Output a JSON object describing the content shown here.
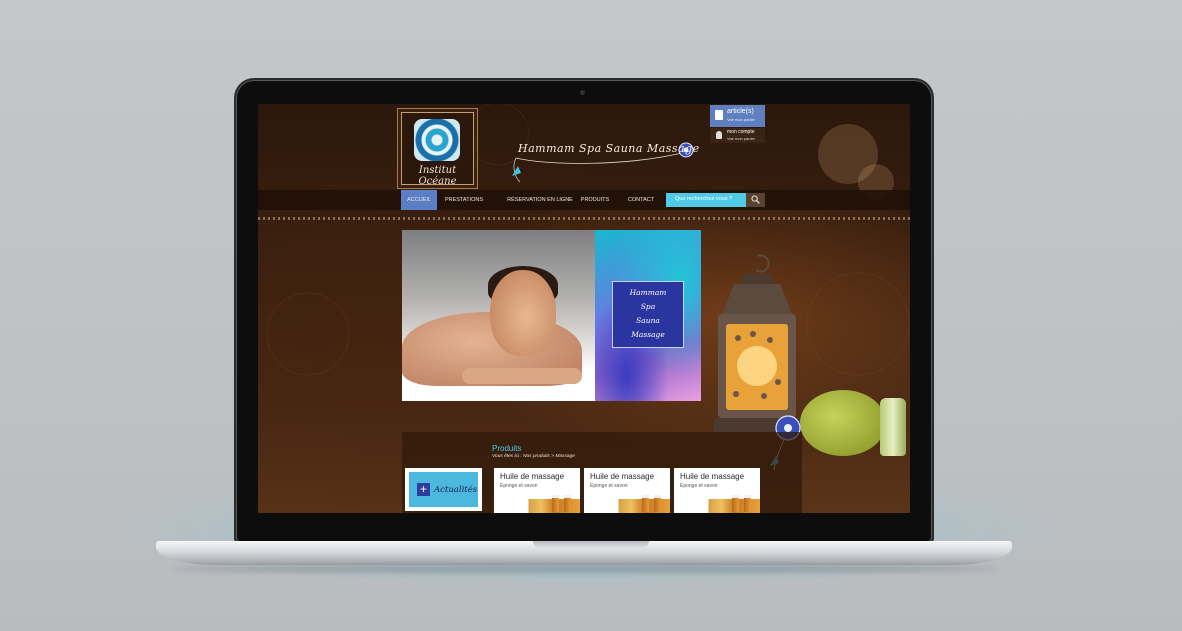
{
  "brand": {
    "name": "Institut Océane",
    "slogan": "Hammam Spa Sauna Massage"
  },
  "cart": {
    "label": "article(s)",
    "link": "Voir mon panier"
  },
  "account": {
    "label": "mon compte",
    "link": "Voir mon panier"
  },
  "nav": {
    "items": [
      "ACCUEIL",
      "PRESTATIONS",
      "RÉSERVATION EN LIGNE",
      "PRODUITS",
      "CONTACT"
    ],
    "active": "ACCUEIL"
  },
  "search": {
    "placeholder": "Que recherchez-vous ?"
  },
  "banner": {
    "lines": [
      "Hammam",
      "Spa",
      "Sauna",
      "Massage"
    ]
  },
  "products": {
    "title": "Produits",
    "breadcrumb": "Vous êtes ici : Nos produits > Massage",
    "news_label": "Actualités",
    "cards": [
      {
        "name": "Huile de massage",
        "subtitle": "Eponge et savon"
      },
      {
        "name": "Huile de massage",
        "subtitle": "Eponge et savon"
      },
      {
        "name": "Huile de massage",
        "subtitle": "Eponge et savon"
      }
    ]
  },
  "colors": {
    "nav_active": "#5a7fc6",
    "accent_cyan": "#4fcbe6",
    "cart_blue": "#5f7fc0",
    "background_brown": "#3a2010"
  },
  "icons": [
    "camera-icon",
    "cart-bag-icon",
    "user-icon",
    "search-icon",
    "flower-icon",
    "leaf-icon",
    "plus-icon"
  ]
}
